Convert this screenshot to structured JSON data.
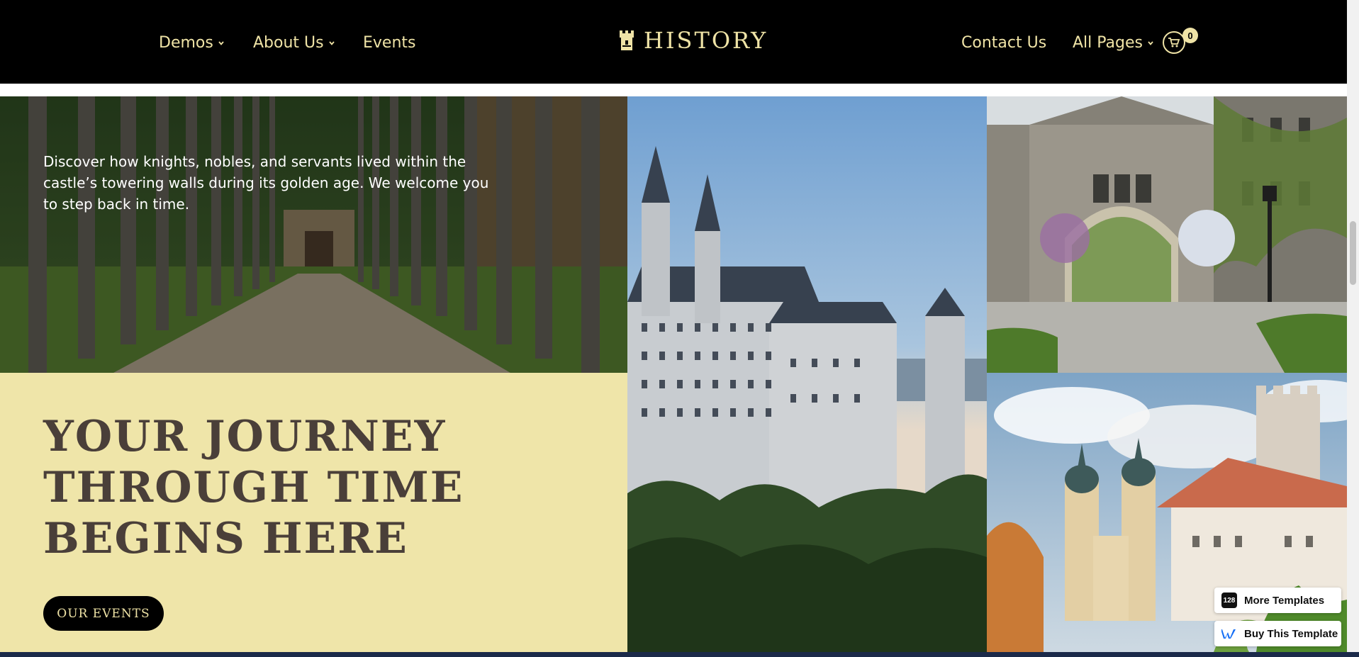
{
  "nav": {
    "left_items": [
      "Demos",
      "About Us",
      "Events"
    ],
    "logo_text": "HISTORY",
    "right_items": [
      "Contact Us",
      "All Pages"
    ],
    "cart_count": "0"
  },
  "hero": {
    "intro": "Discover how knights, nobles, and servants lived within the castle’s towering walls during its golden age. We welcome you to step back in time.",
    "headline": "YOUR JOURNEY THROUGH TIME BEGINS HERE",
    "cta_label": "OUR EVENTS"
  },
  "floating": {
    "more_templates_badge": "128",
    "more_templates_label": "More Templates",
    "buy_template_label": "Buy This Template"
  },
  "colors": {
    "accent": "#efe3a6",
    "cream": "#efe5a9",
    "nav_bg": "#000000",
    "headline": "#4a3f39"
  }
}
